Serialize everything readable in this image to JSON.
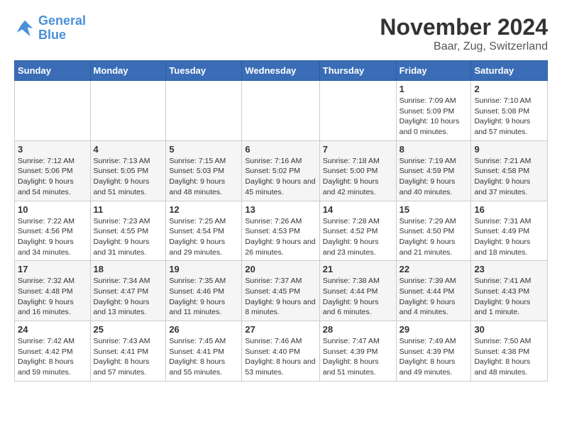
{
  "logo": {
    "line1": "General",
    "line2": "Blue"
  },
  "title": "November 2024",
  "subtitle": "Baar, Zug, Switzerland",
  "weekdays": [
    "Sunday",
    "Monday",
    "Tuesday",
    "Wednesday",
    "Thursday",
    "Friday",
    "Saturday"
  ],
  "weeks": [
    [
      {
        "day": "",
        "info": ""
      },
      {
        "day": "",
        "info": ""
      },
      {
        "day": "",
        "info": ""
      },
      {
        "day": "",
        "info": ""
      },
      {
        "day": "",
        "info": ""
      },
      {
        "day": "1",
        "info": "Sunrise: 7:09 AM\nSunset: 5:09 PM\nDaylight: 10 hours and 0 minutes."
      },
      {
        "day": "2",
        "info": "Sunrise: 7:10 AM\nSunset: 5:08 PM\nDaylight: 9 hours and 57 minutes."
      }
    ],
    [
      {
        "day": "3",
        "info": "Sunrise: 7:12 AM\nSunset: 5:06 PM\nDaylight: 9 hours and 54 minutes."
      },
      {
        "day": "4",
        "info": "Sunrise: 7:13 AM\nSunset: 5:05 PM\nDaylight: 9 hours and 51 minutes."
      },
      {
        "day": "5",
        "info": "Sunrise: 7:15 AM\nSunset: 5:03 PM\nDaylight: 9 hours and 48 minutes."
      },
      {
        "day": "6",
        "info": "Sunrise: 7:16 AM\nSunset: 5:02 PM\nDaylight: 9 hours and 45 minutes."
      },
      {
        "day": "7",
        "info": "Sunrise: 7:18 AM\nSunset: 5:00 PM\nDaylight: 9 hours and 42 minutes."
      },
      {
        "day": "8",
        "info": "Sunrise: 7:19 AM\nSunset: 4:59 PM\nDaylight: 9 hours and 40 minutes."
      },
      {
        "day": "9",
        "info": "Sunrise: 7:21 AM\nSunset: 4:58 PM\nDaylight: 9 hours and 37 minutes."
      }
    ],
    [
      {
        "day": "10",
        "info": "Sunrise: 7:22 AM\nSunset: 4:56 PM\nDaylight: 9 hours and 34 minutes."
      },
      {
        "day": "11",
        "info": "Sunrise: 7:23 AM\nSunset: 4:55 PM\nDaylight: 9 hours and 31 minutes."
      },
      {
        "day": "12",
        "info": "Sunrise: 7:25 AM\nSunset: 4:54 PM\nDaylight: 9 hours and 29 minutes."
      },
      {
        "day": "13",
        "info": "Sunrise: 7:26 AM\nSunset: 4:53 PM\nDaylight: 9 hours and 26 minutes."
      },
      {
        "day": "14",
        "info": "Sunrise: 7:28 AM\nSunset: 4:52 PM\nDaylight: 9 hours and 23 minutes."
      },
      {
        "day": "15",
        "info": "Sunrise: 7:29 AM\nSunset: 4:50 PM\nDaylight: 9 hours and 21 minutes."
      },
      {
        "day": "16",
        "info": "Sunrise: 7:31 AM\nSunset: 4:49 PM\nDaylight: 9 hours and 18 minutes."
      }
    ],
    [
      {
        "day": "17",
        "info": "Sunrise: 7:32 AM\nSunset: 4:48 PM\nDaylight: 9 hours and 16 minutes."
      },
      {
        "day": "18",
        "info": "Sunrise: 7:34 AM\nSunset: 4:47 PM\nDaylight: 9 hours and 13 minutes."
      },
      {
        "day": "19",
        "info": "Sunrise: 7:35 AM\nSunset: 4:46 PM\nDaylight: 9 hours and 11 minutes."
      },
      {
        "day": "20",
        "info": "Sunrise: 7:37 AM\nSunset: 4:45 PM\nDaylight: 9 hours and 8 minutes."
      },
      {
        "day": "21",
        "info": "Sunrise: 7:38 AM\nSunset: 4:44 PM\nDaylight: 9 hours and 6 minutes."
      },
      {
        "day": "22",
        "info": "Sunrise: 7:39 AM\nSunset: 4:44 PM\nDaylight: 9 hours and 4 minutes."
      },
      {
        "day": "23",
        "info": "Sunrise: 7:41 AM\nSunset: 4:43 PM\nDaylight: 9 hours and 1 minute."
      }
    ],
    [
      {
        "day": "24",
        "info": "Sunrise: 7:42 AM\nSunset: 4:42 PM\nDaylight: 8 hours and 59 minutes."
      },
      {
        "day": "25",
        "info": "Sunrise: 7:43 AM\nSunset: 4:41 PM\nDaylight: 8 hours and 57 minutes."
      },
      {
        "day": "26",
        "info": "Sunrise: 7:45 AM\nSunset: 4:41 PM\nDaylight: 8 hours and 55 minutes."
      },
      {
        "day": "27",
        "info": "Sunrise: 7:46 AM\nSunset: 4:40 PM\nDaylight: 8 hours and 53 minutes."
      },
      {
        "day": "28",
        "info": "Sunrise: 7:47 AM\nSunset: 4:39 PM\nDaylight: 8 hours and 51 minutes."
      },
      {
        "day": "29",
        "info": "Sunrise: 7:49 AM\nSunset: 4:39 PM\nDaylight: 8 hours and 49 minutes."
      },
      {
        "day": "30",
        "info": "Sunrise: 7:50 AM\nSunset: 4:38 PM\nDaylight: 8 hours and 48 minutes."
      }
    ]
  ]
}
